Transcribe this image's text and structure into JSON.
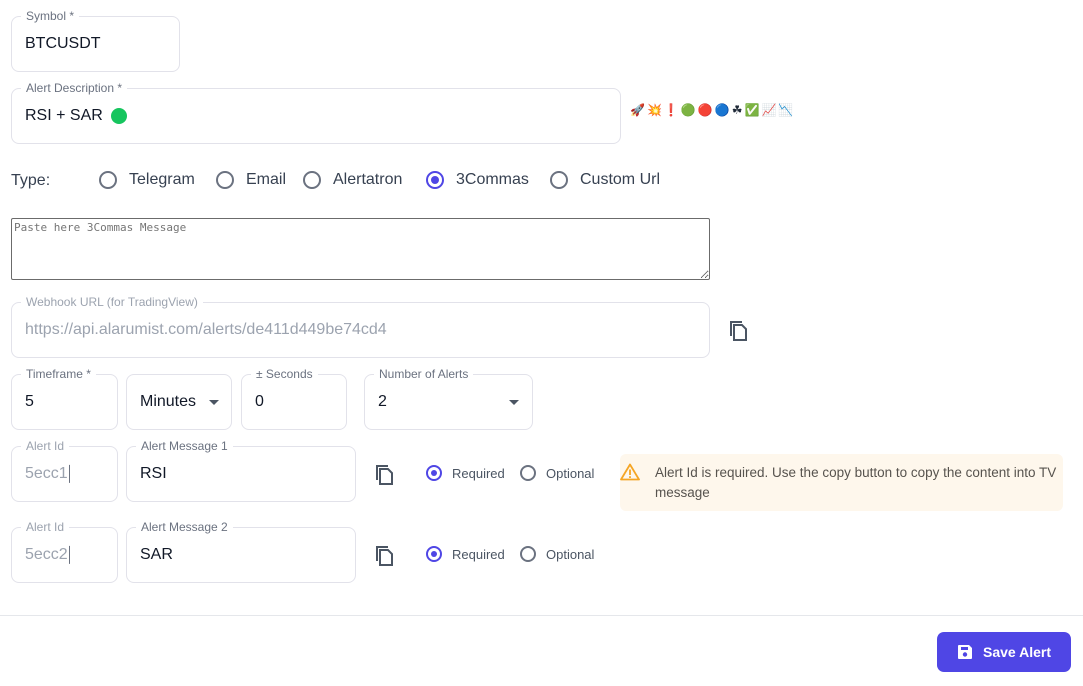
{
  "symbol": {
    "label": "Symbol *",
    "value": "BTCUSDT"
  },
  "description": {
    "label": "Alert Description *",
    "value": "RSI + SAR",
    "status_dot_color": "#16c55e"
  },
  "emoji_palette": [
    {
      "name": "rocket-emoji",
      "glyph": "🚀"
    },
    {
      "name": "explosion-emoji",
      "glyph": "💥"
    },
    {
      "name": "exclamation-emoji",
      "glyph": "❗"
    },
    {
      "name": "green-circle-emoji",
      "glyph": "🟢"
    },
    {
      "name": "red-circle-emoji",
      "glyph": "🔴"
    },
    {
      "name": "blue-circle-emoji",
      "glyph": "🔵"
    },
    {
      "name": "shamrock-emoji",
      "glyph": "☘"
    },
    {
      "name": "check-box-emoji",
      "glyph": "✅"
    },
    {
      "name": "chart-up-emoji",
      "glyph": "📈"
    },
    {
      "name": "chart-down-emoji",
      "glyph": "📉"
    }
  ],
  "type": {
    "label": "Type:",
    "options": [
      "Telegram",
      "Email",
      "Alertatron",
      "3Commas",
      "Custom Url"
    ],
    "selected": "3Commas"
  },
  "message_textarea": {
    "placeholder": "Paste here 3Commas Message",
    "value": ""
  },
  "webhook": {
    "label": "Webhook URL (for TradingView)",
    "value": "https://api.alarumist.com/alerts/de411d449be74cd4"
  },
  "timeframe": {
    "label": "Timeframe *",
    "value": "5"
  },
  "unit": {
    "value": "Minutes"
  },
  "seconds": {
    "label": "± Seconds",
    "value": "0"
  },
  "num_alerts": {
    "label": "Number of Alerts",
    "value": "2"
  },
  "alerts": [
    {
      "id_label": "Alert Id",
      "id_value": "5ecc1",
      "msg_label": "Alert Message 1",
      "msg_value": "RSI",
      "required_label": "Required",
      "optional_label": "Optional",
      "selected": "Required"
    },
    {
      "id_label": "Alert Id",
      "id_value": "5ecc2",
      "msg_label": "Alert Message 2",
      "msg_value": "SAR",
      "required_label": "Required",
      "optional_label": "Optional",
      "selected": "Required"
    }
  ],
  "notice": {
    "text": "Alert Id is required. Use the copy button to copy the content into TV message",
    "bg": "#fef7ec",
    "icon_color": "#f5a524"
  },
  "save_button": {
    "label": "Save Alert",
    "color": "#4f46e5"
  }
}
